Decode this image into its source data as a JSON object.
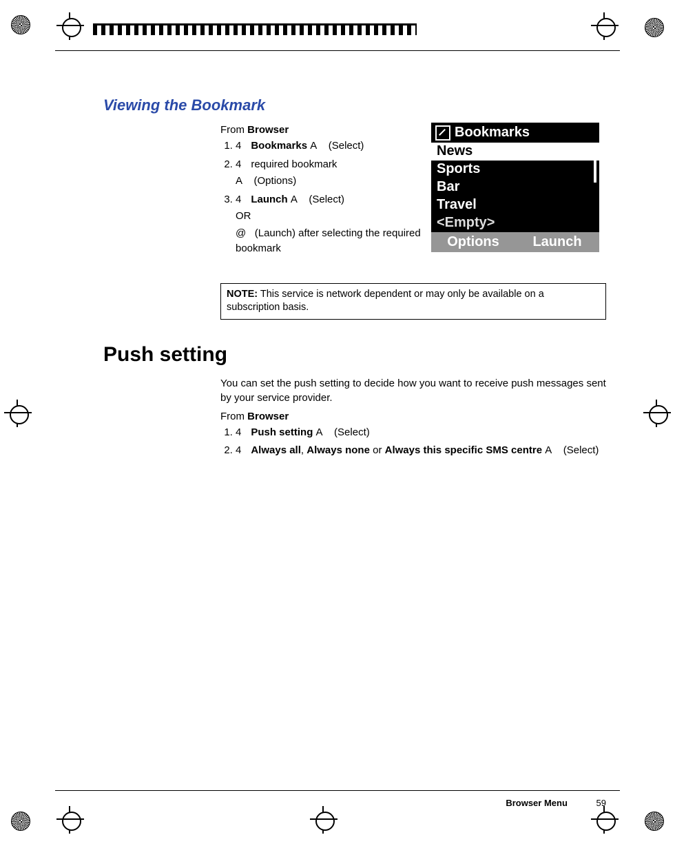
{
  "section_title": "Viewing the Bookmark",
  "from_label": "From",
  "browser_word": "Browser",
  "steps_view": {
    "s1_pre_glyph": "4",
    "s1_bold": "Bookmarks",
    "s1_key": "A",
    "s1_action": "(Select)",
    "s2_pre_glyph": "4",
    "s2_text": "required bookmark",
    "s2_key": "A",
    "s2_action": "(Options)",
    "s3_pre_glyph": "4",
    "s3_bold": "Launch",
    "s3_key": "A",
    "s3_action": "(Select)",
    "or_label": "OR",
    "or_glyph": "@",
    "or_text": "(Launch) after selecting the required bookmark"
  },
  "note": {
    "label": "NOTE:",
    "text": "This service is network dependent or may only be available on a subscription basis."
  },
  "push": {
    "heading": "Push setting",
    "desc": "You can set the push setting to decide how you want to receive push messages sent by your service provider.",
    "s1_pre_glyph": "4",
    "s1_bold": "Push setting",
    "s1_key": "A",
    "s1_action": "(Select)",
    "s2_pre_glyph": "4",
    "s2_opt1": "Always all",
    "s2_sep1": ", ",
    "s2_opt2": "Always none",
    "s2_sep2": " or ",
    "s2_opt3": "Always this specific SMS centre",
    "s2_key": "A",
    "s2_action": "(Select)"
  },
  "phone": {
    "title": "Bookmarks",
    "items": [
      "News",
      "Sports",
      "Bar",
      "Travel",
      "<Empty>"
    ],
    "soft_left": "Options",
    "soft_right": "Launch"
  },
  "footer": {
    "section": "Browser Menu",
    "page": "59"
  }
}
